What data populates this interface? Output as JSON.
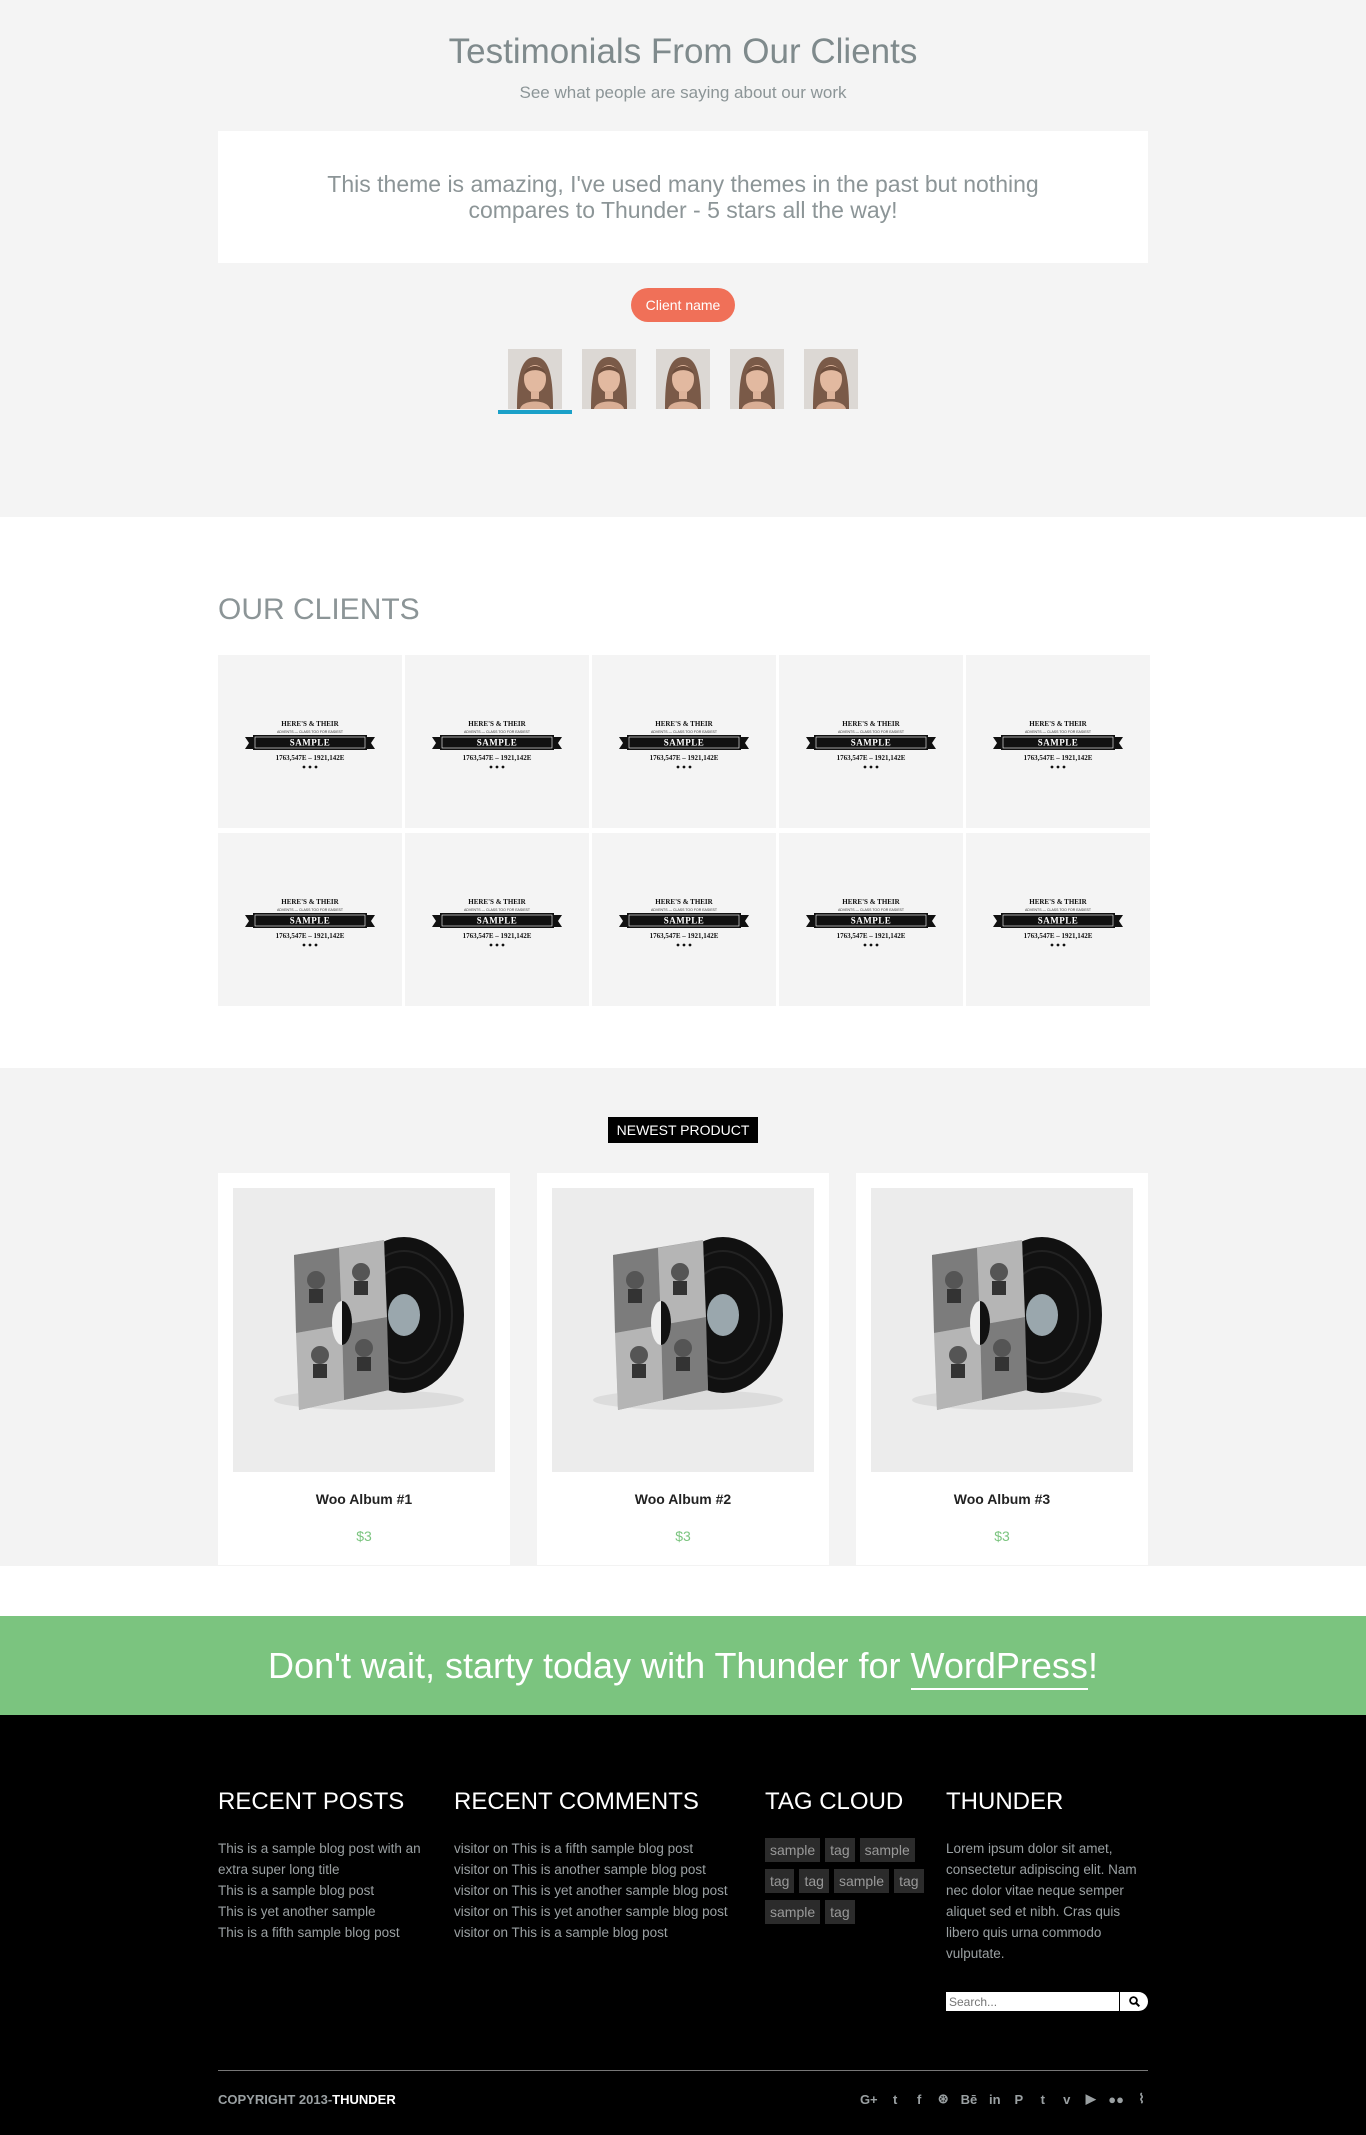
{
  "testimonials": {
    "title": "Testimonials From Our Clients",
    "subtitle": "See what people are saying about our work",
    "quote": "This theme is amazing, I've used many themes in the past but nothing compares to Thunder - 5 stars all the way!",
    "client_button": "Client name",
    "avatar_count": 5,
    "active_avatar": 1
  },
  "clients": {
    "title": "OUR CLIENTS",
    "logo_text": {
      "top": "HERE'S & THEIR",
      "small": "ADVENTS — CLASS TOO FOR EASIEST",
      "banner": "SAMPLE",
      "bottom": "1763,547E – 1921,142E"
    },
    "logo_count": 10
  },
  "products": {
    "badge": "NEWEST PRODUCT",
    "items": [
      {
        "name": "Woo Album #1",
        "price": "$3"
      },
      {
        "name": "Woo Album #2",
        "price": "$3"
      },
      {
        "name": "Woo Album #3",
        "price": "$3"
      }
    ]
  },
  "cta": {
    "text": "Don't wait, starty today with Thunder for ",
    "link": "WordPress",
    "suffix": "!"
  },
  "footer": {
    "recent_posts": {
      "title": "RECENT POSTS",
      "items": [
        "This is a sample blog post with an extra super long title",
        "This is a sample blog post",
        "This is yet another sample",
        "This is a fifth sample blog post"
      ]
    },
    "recent_comments": {
      "title": "RECENT COMMENTS",
      "items": [
        "visitor on This is a fifth sample blog post",
        "visitor on This is another sample blog post",
        "visitor on This is yet another sample blog post",
        "visitor on This is yet another sample blog post",
        "visitor on This is a sample blog post"
      ]
    },
    "tag_cloud": {
      "title": "TAG CLOUD",
      "tags": [
        "sample",
        "tag",
        "sample",
        "tag",
        "tag",
        "sample",
        "tag",
        "sample",
        "tag"
      ]
    },
    "about": {
      "title": "THUNDER",
      "text": "Lorem ipsum dolor sit amet, consectetur adipiscing elit. Nam nec dolor vitae neque semper aliquet sed et nibh. Cras quis libero quis urna commodo vulputate.",
      "search_placeholder": "Search..."
    },
    "copyright": "COPYRIGHT 2013-",
    "brand": "THUNDER",
    "social": [
      {
        "icon": "google-plus-icon",
        "glyph": "G+"
      },
      {
        "icon": "twitter-icon",
        "glyph": "t"
      },
      {
        "icon": "facebook-icon",
        "glyph": "f"
      },
      {
        "icon": "dribbble-icon",
        "glyph": "⊛"
      },
      {
        "icon": "behance-icon",
        "glyph": "Bē"
      },
      {
        "icon": "linkedin-icon",
        "glyph": "in"
      },
      {
        "icon": "pinterest-icon",
        "glyph": "P"
      },
      {
        "icon": "tumblr-icon",
        "glyph": "t"
      },
      {
        "icon": "vimeo-icon",
        "glyph": "v"
      },
      {
        "icon": "youtube-icon",
        "glyph": "▶"
      },
      {
        "icon": "flickr-icon",
        "glyph": "●●"
      },
      {
        "icon": "rss-icon",
        "glyph": "⌇"
      }
    ]
  },
  "colors": {
    "accent_orange": "#f07058",
    "accent_green": "#7bc47f",
    "accent_blue": "#1aa0c8"
  }
}
